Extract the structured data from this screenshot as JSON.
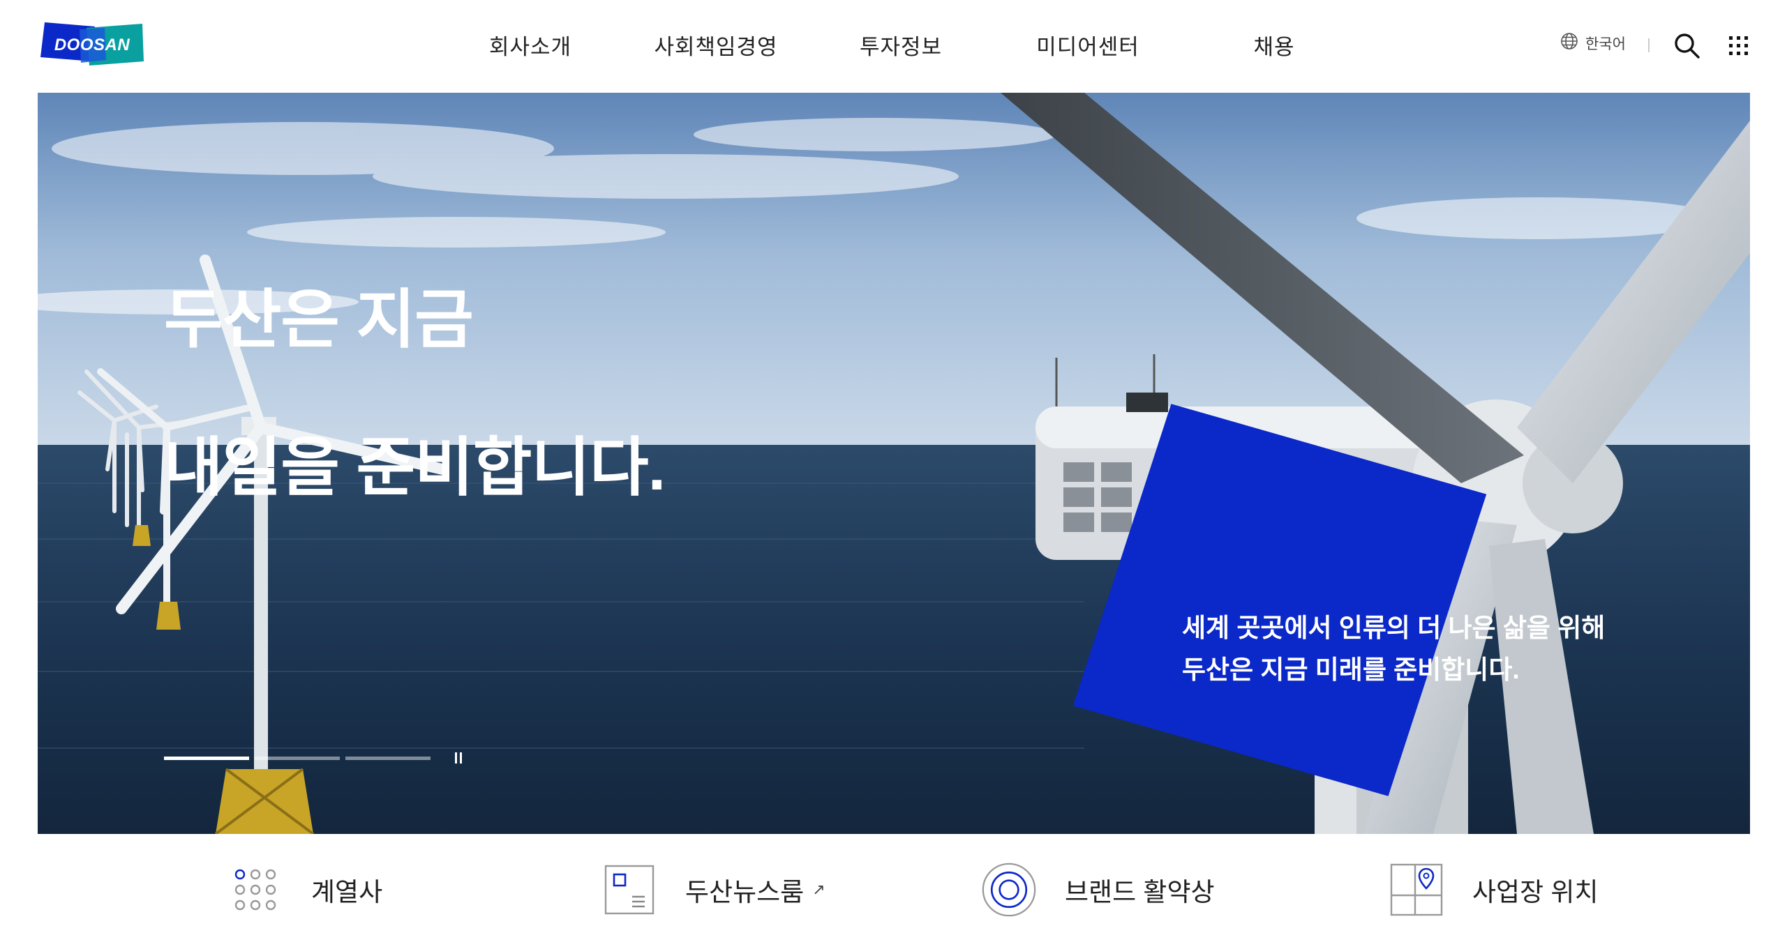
{
  "brand": {
    "logo_text": "DOOSAN",
    "accent": "#0b28c8"
  },
  "nav": {
    "items": [
      {
        "label": "회사소개"
      },
      {
        "label": "사회책임경영"
      },
      {
        "label": "투자정보"
      },
      {
        "label": "미디어센터"
      },
      {
        "label": "채용"
      }
    ]
  },
  "utility": {
    "language_label": "한국어",
    "language_icon": "globe-icon",
    "search_icon": "search-icon",
    "menu_icon": "grid-menu-icon"
  },
  "hero": {
    "title_line1": "두산은 지금",
    "title_line2": "내일을 준비합니다.",
    "subtitle_line1": "세계 곳곳에서 인류의 더 나은 삶을 위해",
    "subtitle_line2": "두산은 지금 미래를 준비합니다.",
    "slides_total": 3,
    "slide_current": 1,
    "slide_progress": 1.0,
    "pause_icon": "pause-icon"
  },
  "quick_links": [
    {
      "label": "계열사",
      "icon": "affiliates-dots-icon"
    },
    {
      "label": "두산뉴스룸",
      "icon": "newsroom-icon",
      "external_mark": "↗"
    },
    {
      "label": "브랜드 활약상",
      "icon": "brand-target-icon"
    },
    {
      "label": "사업장 위치",
      "icon": "map-pin-icon"
    }
  ]
}
